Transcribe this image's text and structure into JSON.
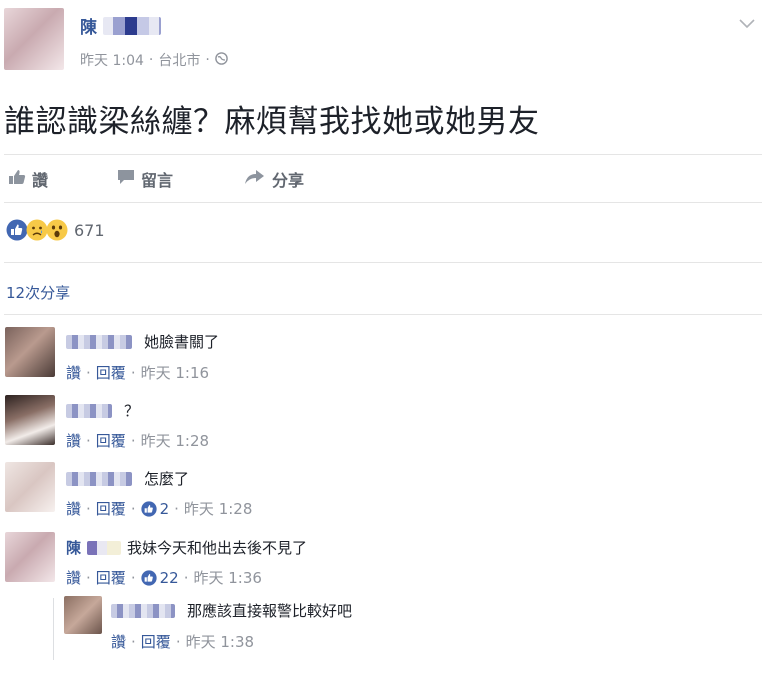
{
  "post": {
    "author_name": "陳",
    "time": "昨天 1:04",
    "location": "台北市",
    "text": "誰認識梁絲纏？麻煩幫我找她或她男友"
  },
  "actions": {
    "like": "讚",
    "comment": "留言",
    "share": "分享"
  },
  "reactions": {
    "count": "671"
  },
  "shares": {
    "label": "12次分享"
  },
  "comments": [
    {
      "name": "",
      "text": "她臉書關了",
      "like": "讚",
      "reply": "回覆",
      "time": "昨天 1:16",
      "likes": ""
    },
    {
      "name": "",
      "text": "？",
      "like": "讚",
      "reply": "回覆",
      "time": "昨天 1:28",
      "likes": ""
    },
    {
      "name": "",
      "text": "怎麼了",
      "like": "讚",
      "reply": "回覆",
      "time": "昨天 1:28",
      "likes": "2"
    },
    {
      "name": "陳",
      "text": "我妹今天和他出去後不見了",
      "like": "讚",
      "reply": "回覆",
      "time": "昨天 1:36",
      "likes": "22"
    }
  ],
  "reply": {
    "name": "",
    "text": "那應該直接報警比較好吧",
    "like": "讚",
    "reply": "回覆",
    "time": "昨天 1:38"
  },
  "colors": {
    "link": "#365899",
    "meta": "#90949c",
    "text": "#1d2129",
    "like_blue": "#4267b2"
  }
}
